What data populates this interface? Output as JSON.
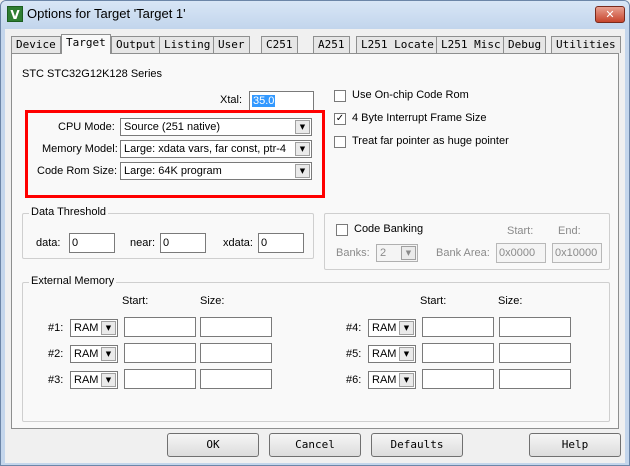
{
  "window": {
    "title": "Options for Target 'Target 1'",
    "close_glyph": "✕",
    "app_icon_glyph": "V"
  },
  "tabs": [
    "Device",
    "Target",
    "Output",
    "Listing",
    "User",
    "C251",
    "A251",
    "L251 Locate",
    "L251 Misc",
    "Debug",
    "Utilities"
  ],
  "active_tab": "Target",
  "target": {
    "series": "STC STC32G12K128 Series",
    "xtal_label": "Xtal:",
    "xtal_value": "35.0",
    "cpu_mode_label": "CPU Mode:",
    "cpu_mode_value": "Source (251 native)",
    "memory_model_label": "Memory Model:",
    "memory_model_value": "Large: xdata vars, far const, ptr-4",
    "code_rom_label": "Code Rom Size:",
    "code_rom_value": "Large: 64K program",
    "opt_onchip": "Use On-chip Code Rom",
    "opt_4byte": "4 Byte Interrupt Frame Size",
    "opt_far": "Treat far pointer as huge pointer",
    "opt_onchip_checked": false,
    "opt_4byte_checked": true,
    "opt_far_checked": false
  },
  "data_threshold": {
    "title": "Data Threshold",
    "data_label": "data:",
    "data_value": "0",
    "near_label": "near:",
    "near_value": "0",
    "xdata_label": "xdata:",
    "xdata_value": "0"
  },
  "code_banking": {
    "label": "Code Banking",
    "checked": false,
    "start_label": "Start:",
    "end_label": "End:",
    "banks_label": "Banks:",
    "banks_value": "2",
    "bank_area_label": "Bank Area:",
    "start_value": "0x0000",
    "end_value": "0x10000"
  },
  "external_memory": {
    "title": "External Memory",
    "start_label": "Start:",
    "size_label": "Size:",
    "left_rows": [
      {
        "label": "#1:",
        "type": "RAM",
        "start": "",
        "size": ""
      },
      {
        "label": "#2:",
        "type": "RAM",
        "start": "",
        "size": ""
      },
      {
        "label": "#3:",
        "type": "RAM",
        "start": "",
        "size": ""
      }
    ],
    "right_rows": [
      {
        "label": "#4:",
        "type": "RAM",
        "start": "",
        "size": ""
      },
      {
        "label": "#5:",
        "type": "RAM",
        "start": "",
        "size": ""
      },
      {
        "label": "#6:",
        "type": "RAM",
        "start": "",
        "size": ""
      }
    ]
  },
  "buttons": {
    "ok": "OK",
    "cancel": "Cancel",
    "defaults": "Defaults",
    "help": "Help"
  },
  "icons": {
    "dropdown_arrow": "▼",
    "check_mark": "✓"
  },
  "colors": {
    "highlight_box": "#ff0000",
    "selection": "#3399ff"
  }
}
